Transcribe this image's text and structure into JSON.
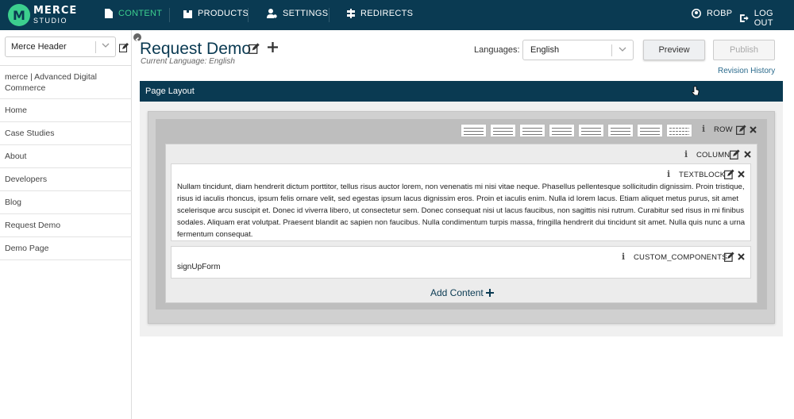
{
  "app": {
    "logo_letter": "M",
    "logo_line1": "MERCE",
    "logo_line2": "STUDIO"
  },
  "nav": {
    "content": "CONTENT",
    "products": "PRODUCTS",
    "settings": "SETTINGS",
    "redirects": "REDIRECTS",
    "user": "ROBP",
    "logout": "LOG OUT"
  },
  "colors": {
    "topbar": "#0a3a52",
    "accent": "#3ccf8e",
    "link": "#2a6a8c"
  },
  "sidebar": {
    "header_select": "Merce Header",
    "items": [
      {
        "label": "merce | Advanced Digital Commerce"
      },
      {
        "label": "Home"
      },
      {
        "label": "Case Studies"
      },
      {
        "label": "About"
      },
      {
        "label": "Developers"
      },
      {
        "label": "Blog"
      },
      {
        "label": "Request Demo"
      },
      {
        "label": "Demo Page"
      }
    ]
  },
  "page": {
    "title": "Request Demo",
    "current_language": "Current Language: English",
    "languages_label": "Languages:",
    "language_value": "English",
    "preview_label": "Preview",
    "publish_label": "Publish",
    "revision_history": "Revision History",
    "layout_label": "Page Layout"
  },
  "builder": {
    "row_label": "ROW",
    "column_label": "COLUMN",
    "textblock_label": "TEXTBLOCK",
    "textblock_text": "Nullam tincidunt, diam hendrerit dictum porttitor, tellus risus auctor lorem, non venenatis mi nisi vitae neque. Phasellus pellentesque sollicitudin dignissim. Proin tristique, risus id iaculis rhoncus, ipsum felis ornare velit, sed egestas ipsum lacus dignissim eros. Proin et iaculis enim. Nulla id lorem lacus. Etiam aliquet metus purus, sit amet scelerisque arcu suscipit et. Donec id viverra libero, ut consectetur sem. Donec consequat nisi ut lacus faucibus, non sagittis nisi rutrum. Curabitur sed risus in mi finibus sodales. Aliquam erat volutpat. Praesent blandit ac sapien non faucibus. Nulla condimentum turpis massa, fringilla hendrerit dui tincidunt sit amet. Nulla quis nunc a urna fermentum consequat.",
    "custom_label": "CUSTOM_COMPONENTS",
    "custom_value": "signUpForm",
    "add_content": "Add Content",
    "info_glyph": "i"
  }
}
